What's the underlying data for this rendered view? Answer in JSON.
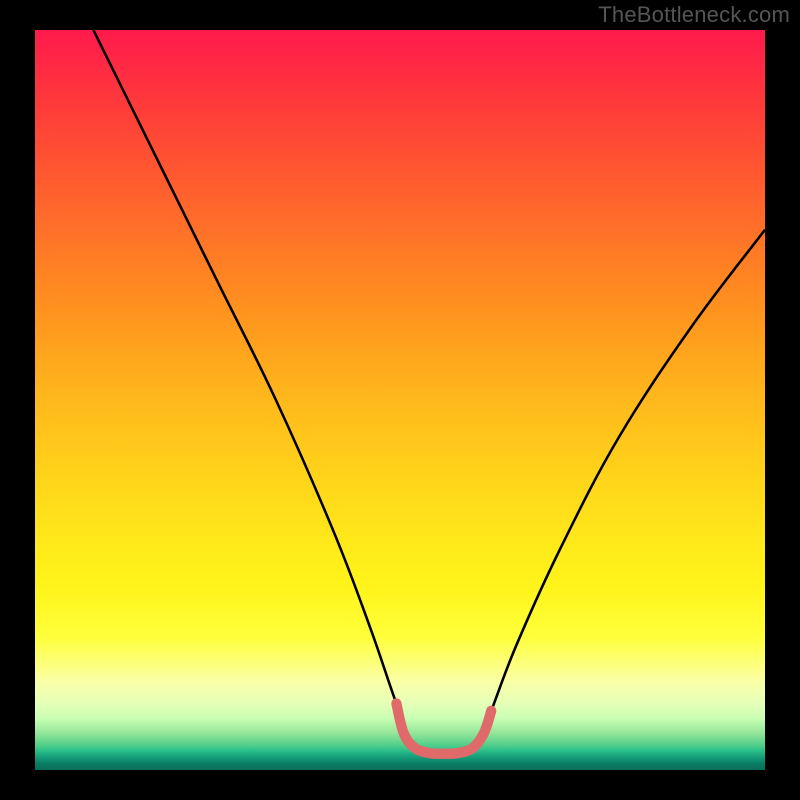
{
  "watermark": "TheBottleneck.com",
  "chart_data": {
    "type": "line",
    "title": "",
    "xlabel": "",
    "ylabel": "",
    "xlim": [
      0,
      100
    ],
    "ylim": [
      0,
      100
    ],
    "series": [
      {
        "name": "bottleneck-curve",
        "x": [
          8,
          12,
          18,
          25,
          33,
          41,
          46,
          49.5,
          52,
          55,
          58,
          60.5,
          62.5,
          66,
          72,
          80,
          90,
          100
        ],
        "y": [
          100,
          92,
          80,
          66,
          50,
          32,
          19,
          9,
          3,
          2,
          2,
          3,
          8,
          17,
          30,
          45,
          60,
          73
        ]
      },
      {
        "name": "optimal-band-marker",
        "x": [
          49.5,
          50.5,
          52,
          54,
          56,
          58,
          60,
          61.5,
          62.5
        ],
        "y": [
          9,
          5,
          3,
          2.3,
          2.2,
          2.3,
          3,
          5,
          8
        ]
      }
    ],
    "gradient_stops": [
      {
        "pos": 0.0,
        "color": "#ff1a4c"
      },
      {
        "pos": 0.1,
        "color": "#ff3a3a"
      },
      {
        "pos": 0.25,
        "color": "#ff6a2a"
      },
      {
        "pos": 0.38,
        "color": "#ff931e"
      },
      {
        "pos": 0.5,
        "color": "#ffb81c"
      },
      {
        "pos": 0.6,
        "color": "#ffd31a"
      },
      {
        "pos": 0.68,
        "color": "#ffe61a"
      },
      {
        "pos": 0.75,
        "color": "#fff41a"
      },
      {
        "pos": 0.82,
        "color": "#ffff3a"
      },
      {
        "pos": 0.88,
        "color": "#faffa6"
      },
      {
        "pos": 0.91,
        "color": "#e6ffb8"
      },
      {
        "pos": 0.93,
        "color": "#c8ffb3"
      },
      {
        "pos": 0.95,
        "color": "#94e69a"
      },
      {
        "pos": 0.965,
        "color": "#58d18a"
      },
      {
        "pos": 0.973,
        "color": "#2fc28a"
      },
      {
        "pos": 0.98,
        "color": "#1aa87e"
      },
      {
        "pos": 0.986,
        "color": "#0f9272"
      },
      {
        "pos": 0.992,
        "color": "#0a7a63"
      },
      {
        "pos": 1.0,
        "color": "#0a6e5a"
      }
    ],
    "colors": {
      "curve": "#000000",
      "marker": "#e06a6a",
      "frame": "#000000"
    }
  }
}
